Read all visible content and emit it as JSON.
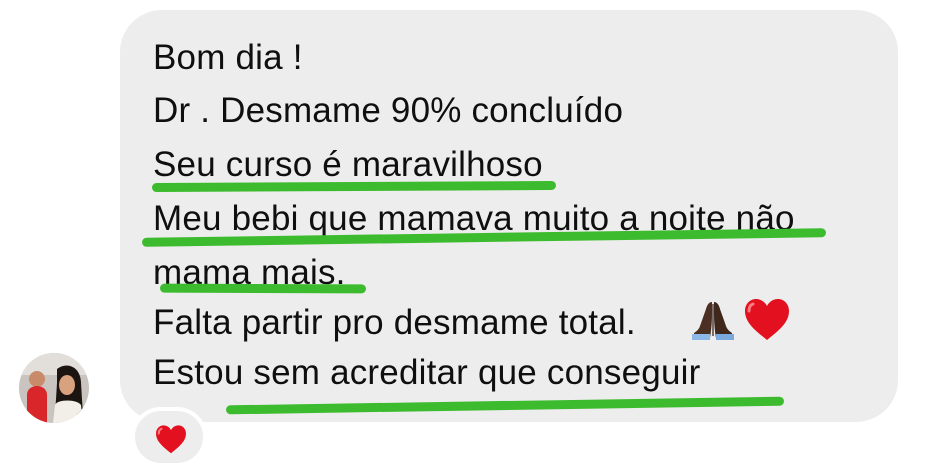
{
  "message": {
    "lines": [
      "Bom dia !",
      "Dr . Desmame 90% concluído",
      "Seu curso é maravilhoso",
      "Meu bebi que mamava muito a noite não",
      "mama mais.",
      "Falta partir pro desmame total.",
      "Estou sem acreditar que conseguir"
    ],
    "inline_emojis": [
      "folded-hands-icon",
      "red-heart-icon"
    ]
  },
  "reaction": {
    "icon": "red-heart-icon"
  },
  "colors": {
    "bubble": "#ededed",
    "text": "#0f0f0f",
    "highlight_underline": "#3dbb2e",
    "heart": "#e3101f"
  }
}
